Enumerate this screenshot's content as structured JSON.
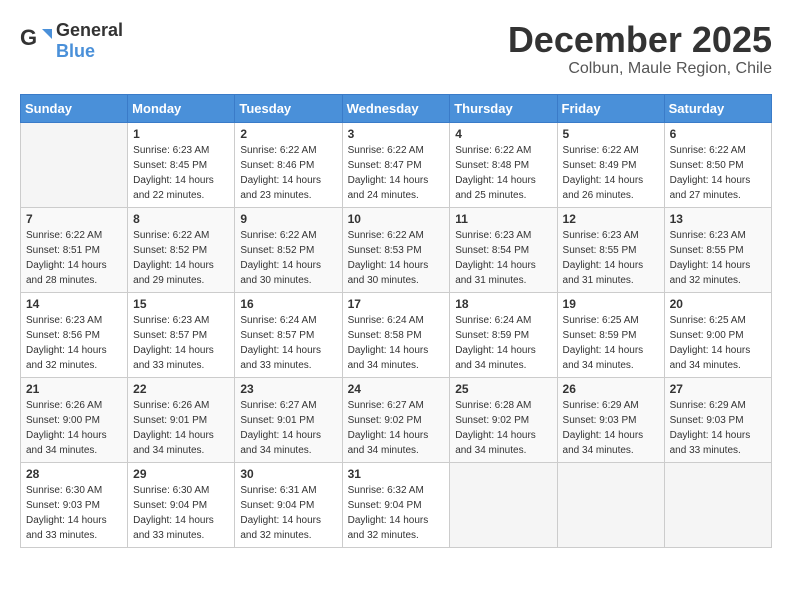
{
  "header": {
    "logo_general": "General",
    "logo_blue": "Blue",
    "month": "December 2025",
    "location": "Colbun, Maule Region, Chile"
  },
  "weekdays": [
    "Sunday",
    "Monday",
    "Tuesday",
    "Wednesday",
    "Thursday",
    "Friday",
    "Saturday"
  ],
  "weeks": [
    [
      {
        "day": "",
        "sunrise": "",
        "sunset": "",
        "daylight": ""
      },
      {
        "day": "1",
        "sunrise": "Sunrise: 6:23 AM",
        "sunset": "Sunset: 8:45 PM",
        "daylight": "Daylight: 14 hours and 22 minutes."
      },
      {
        "day": "2",
        "sunrise": "Sunrise: 6:22 AM",
        "sunset": "Sunset: 8:46 PM",
        "daylight": "Daylight: 14 hours and 23 minutes."
      },
      {
        "day": "3",
        "sunrise": "Sunrise: 6:22 AM",
        "sunset": "Sunset: 8:47 PM",
        "daylight": "Daylight: 14 hours and 24 minutes."
      },
      {
        "day": "4",
        "sunrise": "Sunrise: 6:22 AM",
        "sunset": "Sunset: 8:48 PM",
        "daylight": "Daylight: 14 hours and 25 minutes."
      },
      {
        "day": "5",
        "sunrise": "Sunrise: 6:22 AM",
        "sunset": "Sunset: 8:49 PM",
        "daylight": "Daylight: 14 hours and 26 minutes."
      },
      {
        "day": "6",
        "sunrise": "Sunrise: 6:22 AM",
        "sunset": "Sunset: 8:50 PM",
        "daylight": "Daylight: 14 hours and 27 minutes."
      }
    ],
    [
      {
        "day": "7",
        "sunrise": "Sunrise: 6:22 AM",
        "sunset": "Sunset: 8:51 PM",
        "daylight": "Daylight: 14 hours and 28 minutes."
      },
      {
        "day": "8",
        "sunrise": "Sunrise: 6:22 AM",
        "sunset": "Sunset: 8:52 PM",
        "daylight": "Daylight: 14 hours and 29 minutes."
      },
      {
        "day": "9",
        "sunrise": "Sunrise: 6:22 AM",
        "sunset": "Sunset: 8:52 PM",
        "daylight": "Daylight: 14 hours and 30 minutes."
      },
      {
        "day": "10",
        "sunrise": "Sunrise: 6:22 AM",
        "sunset": "Sunset: 8:53 PM",
        "daylight": "Daylight: 14 hours and 30 minutes."
      },
      {
        "day": "11",
        "sunrise": "Sunrise: 6:23 AM",
        "sunset": "Sunset: 8:54 PM",
        "daylight": "Daylight: 14 hours and 31 minutes."
      },
      {
        "day": "12",
        "sunrise": "Sunrise: 6:23 AM",
        "sunset": "Sunset: 8:55 PM",
        "daylight": "Daylight: 14 hours and 31 minutes."
      },
      {
        "day": "13",
        "sunrise": "Sunrise: 6:23 AM",
        "sunset": "Sunset: 8:55 PM",
        "daylight": "Daylight: 14 hours and 32 minutes."
      }
    ],
    [
      {
        "day": "14",
        "sunrise": "Sunrise: 6:23 AM",
        "sunset": "Sunset: 8:56 PM",
        "daylight": "Daylight: 14 hours and 32 minutes."
      },
      {
        "day": "15",
        "sunrise": "Sunrise: 6:23 AM",
        "sunset": "Sunset: 8:57 PM",
        "daylight": "Daylight: 14 hours and 33 minutes."
      },
      {
        "day": "16",
        "sunrise": "Sunrise: 6:24 AM",
        "sunset": "Sunset: 8:57 PM",
        "daylight": "Daylight: 14 hours and 33 minutes."
      },
      {
        "day": "17",
        "sunrise": "Sunrise: 6:24 AM",
        "sunset": "Sunset: 8:58 PM",
        "daylight": "Daylight: 14 hours and 34 minutes."
      },
      {
        "day": "18",
        "sunrise": "Sunrise: 6:24 AM",
        "sunset": "Sunset: 8:59 PM",
        "daylight": "Daylight: 14 hours and 34 minutes."
      },
      {
        "day": "19",
        "sunrise": "Sunrise: 6:25 AM",
        "sunset": "Sunset: 8:59 PM",
        "daylight": "Daylight: 14 hours and 34 minutes."
      },
      {
        "day": "20",
        "sunrise": "Sunrise: 6:25 AM",
        "sunset": "Sunset: 9:00 PM",
        "daylight": "Daylight: 14 hours and 34 minutes."
      }
    ],
    [
      {
        "day": "21",
        "sunrise": "Sunrise: 6:26 AM",
        "sunset": "Sunset: 9:00 PM",
        "daylight": "Daylight: 14 hours and 34 minutes."
      },
      {
        "day": "22",
        "sunrise": "Sunrise: 6:26 AM",
        "sunset": "Sunset: 9:01 PM",
        "daylight": "Daylight: 14 hours and 34 minutes."
      },
      {
        "day": "23",
        "sunrise": "Sunrise: 6:27 AM",
        "sunset": "Sunset: 9:01 PM",
        "daylight": "Daylight: 14 hours and 34 minutes."
      },
      {
        "day": "24",
        "sunrise": "Sunrise: 6:27 AM",
        "sunset": "Sunset: 9:02 PM",
        "daylight": "Daylight: 14 hours and 34 minutes."
      },
      {
        "day": "25",
        "sunrise": "Sunrise: 6:28 AM",
        "sunset": "Sunset: 9:02 PM",
        "daylight": "Daylight: 14 hours and 34 minutes."
      },
      {
        "day": "26",
        "sunrise": "Sunrise: 6:29 AM",
        "sunset": "Sunset: 9:03 PM",
        "daylight": "Daylight: 14 hours and 34 minutes."
      },
      {
        "day": "27",
        "sunrise": "Sunrise: 6:29 AM",
        "sunset": "Sunset: 9:03 PM",
        "daylight": "Daylight: 14 hours and 33 minutes."
      }
    ],
    [
      {
        "day": "28",
        "sunrise": "Sunrise: 6:30 AM",
        "sunset": "Sunset: 9:03 PM",
        "daylight": "Daylight: 14 hours and 33 minutes."
      },
      {
        "day": "29",
        "sunrise": "Sunrise: 6:30 AM",
        "sunset": "Sunset: 9:04 PM",
        "daylight": "Daylight: 14 hours and 33 minutes."
      },
      {
        "day": "30",
        "sunrise": "Sunrise: 6:31 AM",
        "sunset": "Sunset: 9:04 PM",
        "daylight": "Daylight: 14 hours and 32 minutes."
      },
      {
        "day": "31",
        "sunrise": "Sunrise: 6:32 AM",
        "sunset": "Sunset: 9:04 PM",
        "daylight": "Daylight: 14 hours and 32 minutes."
      },
      {
        "day": "",
        "sunrise": "",
        "sunset": "",
        "daylight": ""
      },
      {
        "day": "",
        "sunrise": "",
        "sunset": "",
        "daylight": ""
      },
      {
        "day": "",
        "sunrise": "",
        "sunset": "",
        "daylight": ""
      }
    ]
  ]
}
